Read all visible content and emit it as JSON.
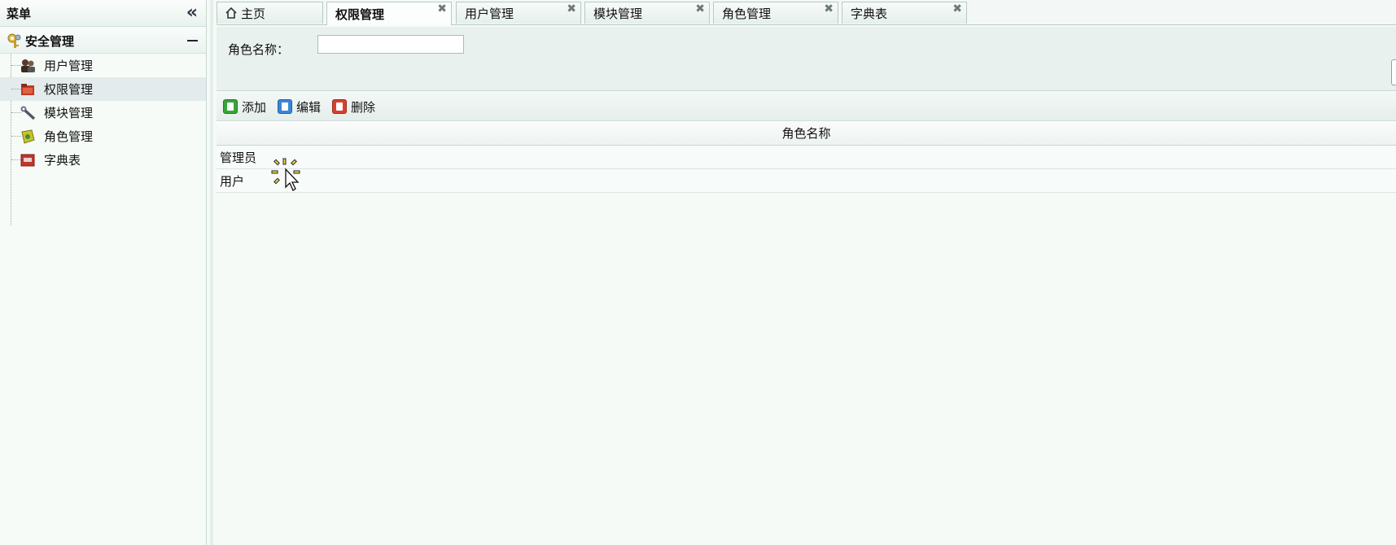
{
  "sidebar": {
    "title": "菜单",
    "collapse_icon": "double-chevron-left-icon",
    "group": {
      "label": "安全管理",
      "icon": "keys-icon"
    },
    "items": [
      {
        "label": "用户管理",
        "icon": "users-icon"
      },
      {
        "label": "权限管理",
        "icon": "folder-red-icon",
        "active": true
      },
      {
        "label": "模块管理",
        "icon": "wrench-icon"
      },
      {
        "label": "角色管理",
        "icon": "role-badge-icon"
      },
      {
        "label": "字典表",
        "icon": "book-red-icon"
      }
    ]
  },
  "tabs": [
    {
      "label": "主页",
      "icon": "home-icon",
      "closable": false
    },
    {
      "label": "权限管理",
      "active": true,
      "closable": true
    },
    {
      "label": "用户管理",
      "closable": true
    },
    {
      "label": "模块管理",
      "closable": true
    },
    {
      "label": "角色管理",
      "closable": true
    },
    {
      "label": "字典表",
      "closable": true
    }
  ],
  "tab_close_glyph": "✖",
  "search": {
    "label": "角色名称：",
    "value": ""
  },
  "toolbar": {
    "add_label": "添加",
    "edit_label": "编辑",
    "delete_label": "删除"
  },
  "grid": {
    "column_header": "角色名称",
    "rows": [
      "管理员",
      "用户"
    ]
  },
  "colors": {
    "active_item_bg": "#e3ebec",
    "border": "#b7cbc2",
    "panel_bg": "#e8f1ed"
  }
}
